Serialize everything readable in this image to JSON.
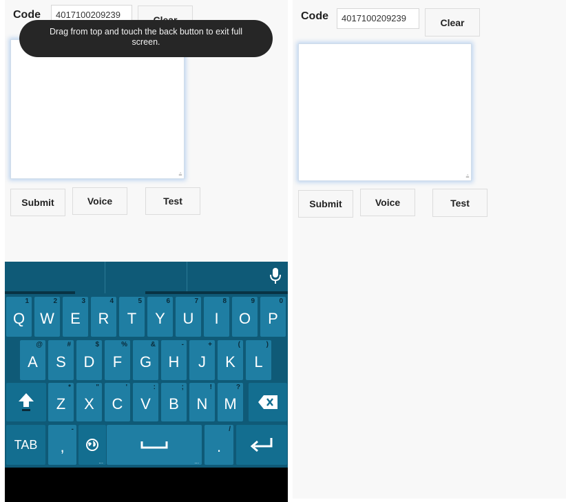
{
  "left": {
    "code_label": "Code",
    "code_value": "4017100209239",
    "clear_label": "Clear",
    "submit_label": "Submit",
    "voice_label": "Voice",
    "test_label": "Test",
    "toast_text": "Drag from top and touch the back button to exit full screen."
  },
  "right": {
    "code_label": "Code",
    "code_value": "4017100209239",
    "clear_label": "Clear",
    "submit_label": "Submit",
    "voice_label": "Voice",
    "test_label": "Test"
  },
  "keyboard": {
    "row1": [
      {
        "key": "Q",
        "hint": "1"
      },
      {
        "key": "W",
        "hint": "2"
      },
      {
        "key": "E",
        "hint": "3"
      },
      {
        "key": "R",
        "hint": "4"
      },
      {
        "key": "T",
        "hint": "5"
      },
      {
        "key": "Y",
        "hint": "6"
      },
      {
        "key": "U",
        "hint": "7"
      },
      {
        "key": "I",
        "hint": "8"
      },
      {
        "key": "O",
        "hint": "9"
      },
      {
        "key": "P",
        "hint": "0"
      }
    ],
    "row2": [
      {
        "key": "A",
        "hint": "@"
      },
      {
        "key": "S",
        "hint": "#"
      },
      {
        "key": "D",
        "hint": "$"
      },
      {
        "key": "F",
        "hint": "%"
      },
      {
        "key": "G",
        "hint": "&"
      },
      {
        "key": "H",
        "hint": "-"
      },
      {
        "key": "J",
        "hint": "+"
      },
      {
        "key": "K",
        "hint": "("
      },
      {
        "key": "L",
        "hint": ")"
      }
    ],
    "row3": [
      {
        "key": "Z",
        "hint": "*"
      },
      {
        "key": "X",
        "hint": "\""
      },
      {
        "key": "C",
        "hint": "'"
      },
      {
        "key": "V",
        "hint": ":"
      },
      {
        "key": "B",
        "hint": ";"
      },
      {
        "key": "N",
        "hint": "!"
      },
      {
        "key": "M",
        "hint": "?"
      }
    ],
    "tab_label": "TAB",
    "comma_label": ",",
    "comma_hint": "-",
    "period_label": ".",
    "period_hint": "/",
    "more_dots": "...",
    "colors": {
      "background": "#0f5a77",
      "key": "#1f7ea3",
      "hint": "#0a2a38"
    }
  }
}
